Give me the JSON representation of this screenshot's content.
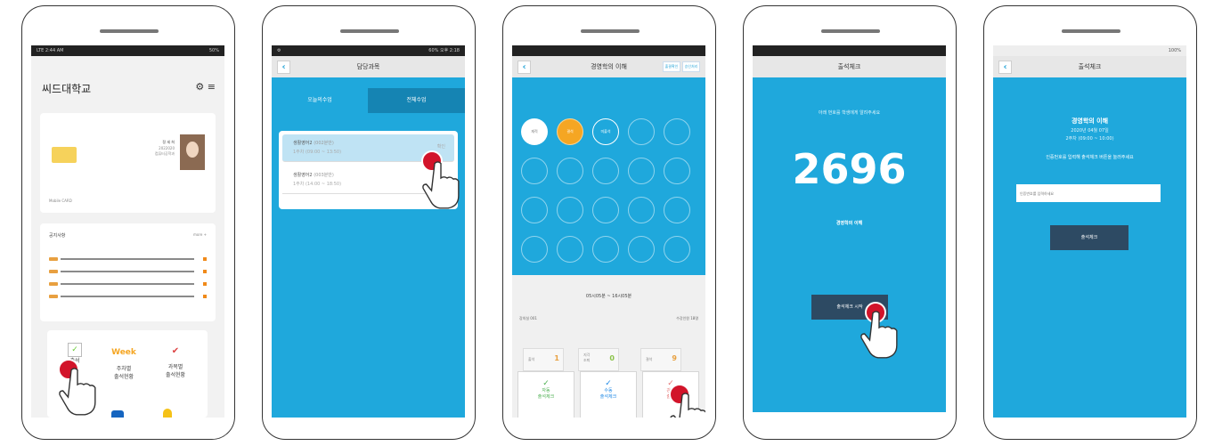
{
  "colors": {
    "primary": "#1fa8dc",
    "accent": "#f5a623",
    "tap_marker": "#d2142a",
    "dark_button": "#2d4a63"
  },
  "step1": {
    "status_left": "LTE 2:44 AM",
    "status_right": "50%",
    "app_title": "씨드대학교",
    "icons": [
      "gear-icon",
      "menu-icon"
    ],
    "student_card": {
      "name": "정 세 희",
      "line1": "2022020",
      "line2": "컴퓨터공학과",
      "footer": "Mobile CARD"
    },
    "notice_title": "공지사항",
    "notice_more": "more +",
    "notices": [
      {
        "tag": "학사"
      },
      {
        "tag": "학사"
      },
      {
        "tag": "학사"
      },
      {
        "tag": "학사"
      }
    ],
    "menu": [
      {
        "label": "출석"
      },
      {
        "label": "주차별\n출석현황"
      },
      {
        "label": "과목별\n출석현황"
      }
    ]
  },
  "step2": {
    "status_right": "60% 오후 2:18",
    "header": "담당과목",
    "tabs": [
      "오늘의수업",
      "전체수업"
    ],
    "courses": [
      {
        "name": "생활영어2",
        "code": "(002분반)",
        "time": "1주차 (09:00 ~ 13:50)",
        "tag": "확인"
      },
      {
        "name": "생활영어2",
        "code": "(003분반)",
        "time": "1주차 (14:00 ~ 18:50)",
        "tag": "확인"
      }
    ]
  },
  "step3": {
    "header": "경영학의 이해",
    "header_buttons": [
      "출결확인",
      "승인처리"
    ],
    "seat_labels": [
      "재적",
      "결석",
      "미출석"
    ],
    "range": "05시05분 ~ 16시05분",
    "left_info": "강의실 001",
    "right_info": "수강인원 18명",
    "stats": [
      {
        "label": "출석",
        "value": "1"
      },
      {
        "label": "지각\n조퇴",
        "value": "0"
      },
      {
        "label": "결석",
        "value": "9"
      }
    ],
    "actions": [
      {
        "label": "자동\n출석체크"
      },
      {
        "label": "수동\n출석체크"
      },
      {
        "label": "강제\n출석"
      }
    ]
  },
  "step4": {
    "header": "출석체크",
    "instruction": "아래 번호를 학생에게 알려주세요",
    "code": "2696",
    "course": "경영학의 이해",
    "button": "출석체크 시작"
  },
  "step5": {
    "status_right": "100%",
    "header": "출석체크",
    "course": "경영학의 이해",
    "date": "2020년 04월 07일",
    "period": "2주차 (09:00 ~ 10:00)",
    "instruction": "인증번호를 입력해 출석체크 버튼을 눌러주세요",
    "placeholder": "인증번호를 입력하세요",
    "button": "출석체크"
  }
}
